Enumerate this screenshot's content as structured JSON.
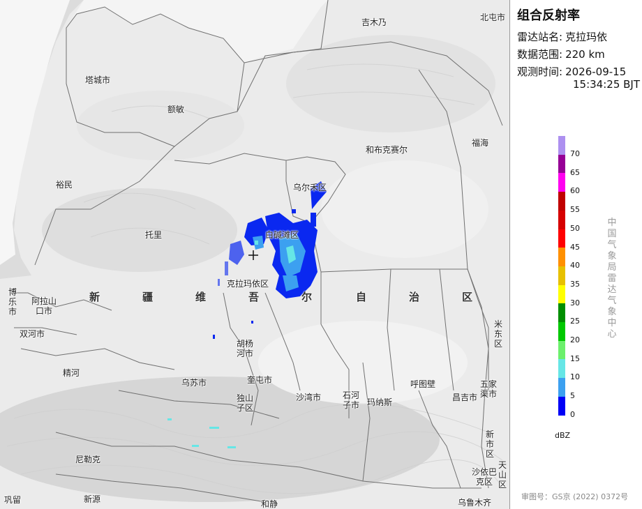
{
  "panel": {
    "title": "组合反射率",
    "station_label": "雷达站名:",
    "station_value": "克拉玛依",
    "range_label": "数据范围:",
    "range_value": "220 km",
    "time_label": "观测时间:",
    "time_date": "2026-09-15",
    "time_clock": "15:34:25 BJT",
    "agency": "中国气象局雷达气象中心",
    "review_number": "审图号：GS京 (2022) 0372号"
  },
  "legend": {
    "unit": "dBZ",
    "levels": [
      {
        "label": "70",
        "color": "#ad90f0"
      },
      {
        "label": "65",
        "color": "#960096"
      },
      {
        "label": "60",
        "color": "#ff00f0"
      },
      {
        "label": "55",
        "color": "#c00000"
      },
      {
        "label": "50",
        "color": "#d60000"
      },
      {
        "label": "45",
        "color": "#ff0000"
      },
      {
        "label": "40",
        "color": "#ff9000"
      },
      {
        "label": "35",
        "color": "#e7c000"
      },
      {
        "label": "30",
        "color": "#ffff00"
      },
      {
        "label": "25",
        "color": "#008e00"
      },
      {
        "label": "20",
        "color": "#00c800"
      },
      {
        "label": "15",
        "color": "#6cf06c"
      },
      {
        "label": "10",
        "color": "#66e6e6"
      },
      {
        "label": "5",
        "color": "#3ca0f0"
      },
      {
        "label": "0",
        "color": "#0000f6"
      }
    ]
  },
  "map": {
    "region_label": [
      "新",
      "疆",
      "维",
      "吾",
      "尔",
      "自",
      "治",
      "区"
    ],
    "places": {
      "jimunai": "吉木乃",
      "beitun": "北屯市",
      "tacheng": "塔城市",
      "emin": "额敏",
      "hebukesaier": "和布克赛尔",
      "fuhai": "福海",
      "yumin": "裕民",
      "wuerhe": "乌尔禾区",
      "tuoli": "托里",
      "baijiantan": "白碱滩区",
      "karamay_dist": "克拉玛依区",
      "bole": "博乐市",
      "alashankou": "阿拉山口市",
      "shuanghe": "双河市",
      "huyanghe": "胡杨河市",
      "jinghe": "精河",
      "wusu": "乌苏市",
      "kuitun": "奎屯市",
      "dushanzi": "独山子区",
      "shawan": "沙湾市",
      "shihezi": "石河子市",
      "manas": "玛纳斯",
      "hutubi": "呼图壁",
      "changji": "昌吉市",
      "wujiaqu": "五家渠市",
      "midong": "米东区",
      "xinshi": "新市区",
      "tianshan": "天山区",
      "shayibake": "沙依巴克区",
      "nileke": "尼勒克",
      "xinyuan": "新源",
      "gongliu": "巩留",
      "hejing": "和静",
      "urumqi": "乌鲁木齐"
    }
  }
}
